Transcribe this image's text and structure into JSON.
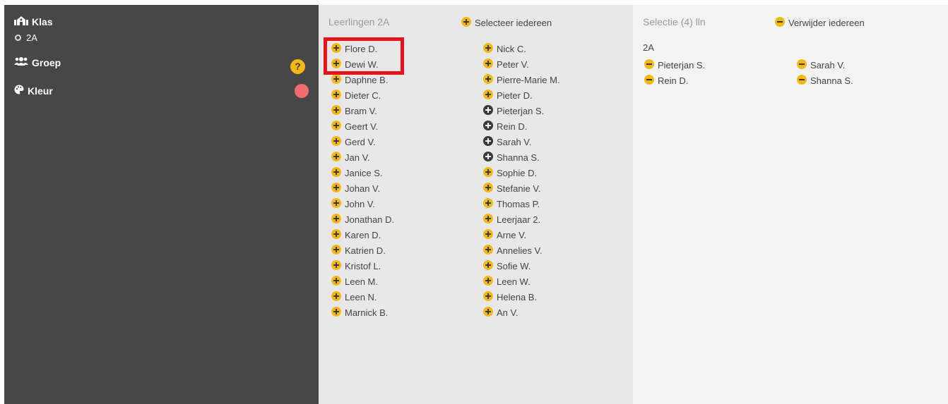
{
  "colors": {
    "sidebar_bg": "#474747",
    "students_bg": "#e8e8e8",
    "selection_bg": "#f3f3f3",
    "accent": "#f5b916",
    "selected_icon": "#3a3a3a",
    "color_swatch": "#f36b6b",
    "highlight": "#e8121b"
  },
  "sidebar": {
    "klas_label": "Klas",
    "klas_value": "2A",
    "groep_label": "Groep",
    "help_symbol": "?",
    "kleur_label": "Kleur"
  },
  "students": {
    "title": "Leerlingen 2A",
    "select_all": "Selecteer iedereen",
    "col1": [
      {
        "name": "Flore D.",
        "selected": false
      },
      {
        "name": "Dewi W.",
        "selected": false
      },
      {
        "name": "Daphne B.",
        "selected": false
      },
      {
        "name": "Dieter C.",
        "selected": false
      },
      {
        "name": "Bram V.",
        "selected": false
      },
      {
        "name": "Geert V.",
        "selected": false
      },
      {
        "name": "Gerd V.",
        "selected": false
      },
      {
        "name": "Jan V.",
        "selected": false
      },
      {
        "name": "Janice S.",
        "selected": false
      },
      {
        "name": "Johan V.",
        "selected": false
      },
      {
        "name": "John V.",
        "selected": false
      },
      {
        "name": "Jonathan D.",
        "selected": false
      },
      {
        "name": "Karen D.",
        "selected": false
      },
      {
        "name": "Katrien D.",
        "selected": false
      },
      {
        "name": "Kristof L.",
        "selected": false
      },
      {
        "name": "Leen M.",
        "selected": false
      },
      {
        "name": "Leen N.",
        "selected": false
      },
      {
        "name": "Marnick B.",
        "selected": false
      }
    ],
    "col2": [
      {
        "name": "Nick C.",
        "selected": false
      },
      {
        "name": "Peter V.",
        "selected": false
      },
      {
        "name": "Pierre-Marie M.",
        "selected": false
      },
      {
        "name": "Pieter D.",
        "selected": false
      },
      {
        "name": "Pieterjan S.",
        "selected": true
      },
      {
        "name": "Rein D.",
        "selected": true
      },
      {
        "name": "Sarah V.",
        "selected": true
      },
      {
        "name": "Shanna S.",
        "selected": true
      },
      {
        "name": "Sophie D.",
        "selected": false
      },
      {
        "name": "Stefanie V.",
        "selected": false
      },
      {
        "name": "Thomas P.",
        "selected": false
      },
      {
        "name": "Leerjaar 2.",
        "selected": false
      },
      {
        "name": "Arne V.",
        "selected": false
      },
      {
        "name": "Annelies V.",
        "selected": false
      },
      {
        "name": "Sofie W.",
        "selected": false
      },
      {
        "name": "Leen W.",
        "selected": false
      },
      {
        "name": "Helena B.",
        "selected": false
      },
      {
        "name": "An V.",
        "selected": false
      }
    ]
  },
  "selection": {
    "title": "Selectie (4) lln",
    "remove_all": "Verwijder iedereen",
    "group": "2A",
    "col1": [
      "Pieterjan S.",
      "Rein D."
    ],
    "col2": [
      "Sarah V.",
      "Shanna S."
    ]
  }
}
